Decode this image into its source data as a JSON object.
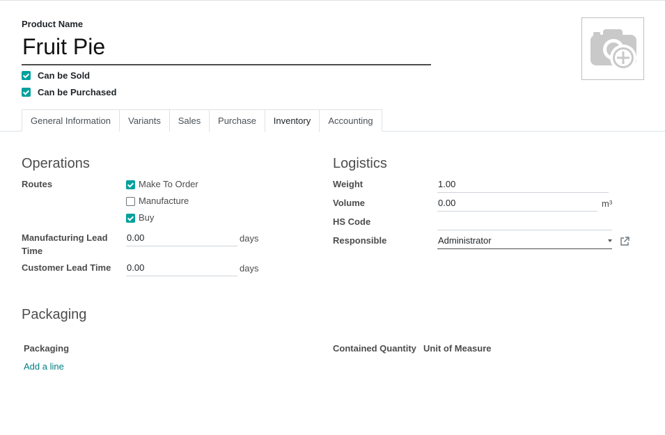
{
  "header": {
    "product_name_label": "Product Name",
    "product_name": "Fruit Pie",
    "can_be_sold": {
      "label": "Can be Sold",
      "checked": true
    },
    "can_be_purchased": {
      "label": "Can be Purchased",
      "checked": true
    },
    "image_icon": "camera-plus-icon"
  },
  "tabs": [
    {
      "label": "General Information",
      "active": false
    },
    {
      "label": "Variants",
      "active": false
    },
    {
      "label": "Sales",
      "active": false
    },
    {
      "label": "Purchase",
      "active": false
    },
    {
      "label": "Inventory",
      "active": true
    },
    {
      "label": "Accounting",
      "active": false
    }
  ],
  "operations": {
    "title": "Operations",
    "routes_label": "Routes",
    "routes": [
      {
        "label": "Make To Order",
        "checked": true
      },
      {
        "label": "Manufacture",
        "checked": false
      },
      {
        "label": "Buy",
        "checked": true
      }
    ],
    "manufacturing_lead_time": {
      "label": "Manufacturing Lead Time",
      "value": "0.00",
      "unit": "days"
    },
    "customer_lead_time": {
      "label": "Customer Lead Time",
      "value": "0.00",
      "unit": "days"
    }
  },
  "logistics": {
    "title": "Logistics",
    "weight": {
      "label": "Weight",
      "value": "1.00"
    },
    "volume": {
      "label": "Volume",
      "value": "0.00",
      "unit": "m³"
    },
    "hs_code": {
      "label": "HS Code",
      "value": ""
    },
    "responsible": {
      "label": "Responsible",
      "value": "Administrator",
      "dropdown_icon": "caret-down-icon",
      "link_icon": "external-link-icon"
    }
  },
  "packaging": {
    "title": "Packaging",
    "columns": [
      "Packaging",
      "Contained Quantity",
      "Unit of Measure"
    ],
    "add_line": "Add a line"
  },
  "colors": {
    "accent": "#00A09D",
    "link": "#017e84"
  }
}
